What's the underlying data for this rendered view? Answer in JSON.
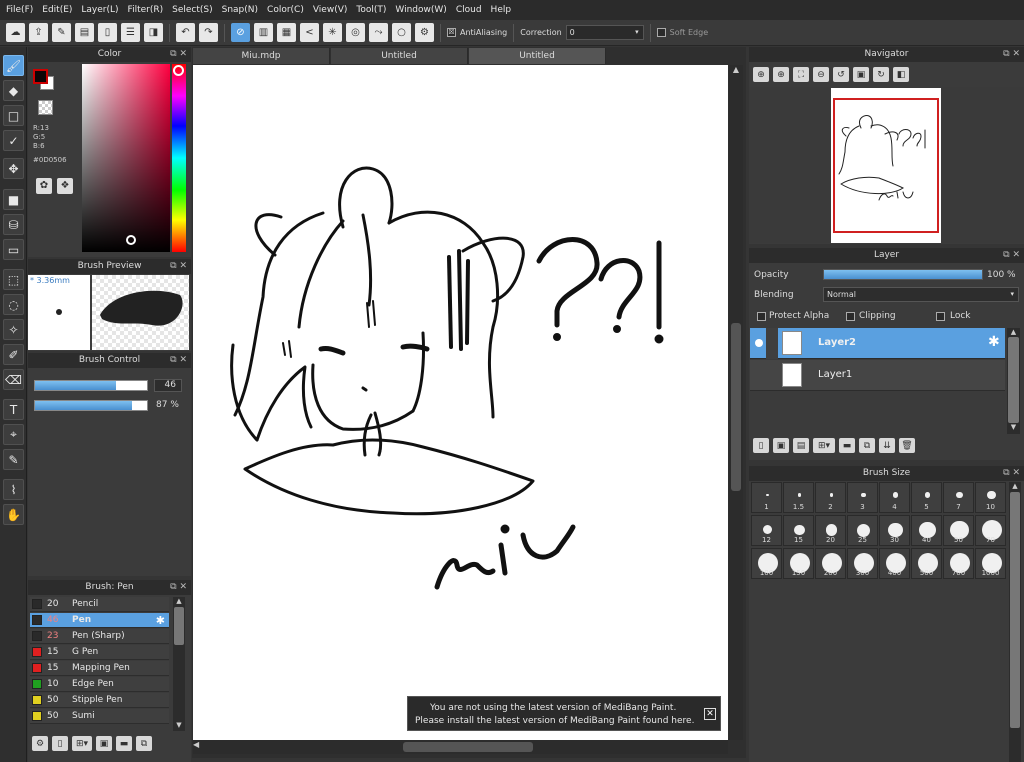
{
  "menu": [
    "File(F)",
    "Edit(E)",
    "Layer(L)",
    "Filter(R)",
    "Select(S)",
    "Snap(N)",
    "Color(C)",
    "View(V)",
    "Tool(T)",
    "Window(W)",
    "Cloud",
    "Help"
  ],
  "toolbar": {
    "antialiasing_label": "AntiAliasing",
    "antialiasing_checked": "☒",
    "correction_label": "Correction",
    "correction_value": "0",
    "soft_edge_label": "Soft Edge"
  },
  "tabs": [
    "Miu.mdp",
    "Untitled",
    "Untitled"
  ],
  "color_panel": {
    "title": "Color",
    "r": "R:13",
    "g": "G:5",
    "b": "B:6",
    "hex": "#0D0506",
    "foreground": "#0d0506",
    "hue_color": "#ff0040"
  },
  "brush_preview": {
    "title": "Brush Preview",
    "size": "* 3.36mm"
  },
  "brush_control": {
    "title": "Brush Control",
    "size_value": "46",
    "opacity_value": "87 %",
    "size_fill": 0.72,
    "opacity_fill": 0.87
  },
  "brush_list": {
    "title": "Brush: Pen",
    "items": [
      {
        "size": "20",
        "name": "Pencil",
        "color": "#2a2a2a"
      },
      {
        "size": "46",
        "name": "Pen",
        "color": "#2a2a2a"
      },
      {
        "size": "23",
        "name": "Pen (Sharp)",
        "color": "#2a2a2a"
      },
      {
        "size": "15",
        "name": "G Pen",
        "color": "#e02020"
      },
      {
        "size": "15",
        "name": "Mapping Pen",
        "color": "#e02020"
      },
      {
        "size": "10",
        "name": "Edge Pen",
        "color": "#20a020"
      },
      {
        "size": "50",
        "name": "Stipple Pen",
        "color": "#e0d020"
      },
      {
        "size": "50",
        "name": "Sumi",
        "color": "#e0d020"
      }
    ]
  },
  "navigator": {
    "title": "Navigator"
  },
  "layer_panel": {
    "title": "Layer",
    "opacity_label": "Opacity",
    "opacity_value": "100 %",
    "blending_label": "Blending",
    "blending_value": "Normal",
    "protect_alpha": "Protect Alpha",
    "clipping": "Clipping",
    "lock": "Lock",
    "layers": [
      "Layer2",
      "Layer1"
    ]
  },
  "brush_size": {
    "title": "Brush Size",
    "sizes": [
      "1",
      "1.5",
      "2",
      "3",
      "4",
      "5",
      "7",
      "10",
      "12",
      "15",
      "20",
      "25",
      "30",
      "40",
      "50",
      "70",
      "100",
      "150",
      "200",
      "300",
      "400",
      "500",
      "700",
      "1000"
    ]
  },
  "notification": {
    "line1": "You are not using the latest version of MediBang Paint.",
    "line2": "Please install the latest version of MediBang Paint found here."
  },
  "canvas_text": "Miu ??!"
}
